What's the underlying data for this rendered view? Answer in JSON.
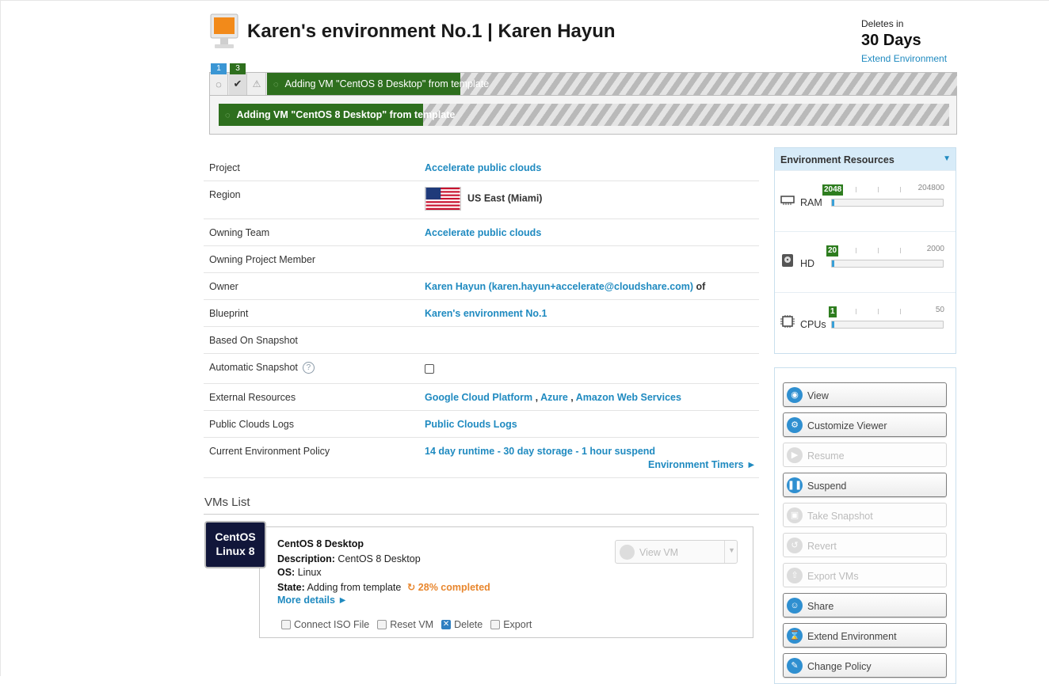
{
  "header": {
    "title": "Karen's environment No.1 | Karen Hayun",
    "deletes_label": "Deletes in",
    "deletes_value": "30 Days",
    "extend_link": "Extend Environment"
  },
  "taskbar": {
    "running_count": "1",
    "done_count": "3",
    "task_text": "Adding VM \"CentOS 8 Desktop\" from template",
    "progress_percent": 28
  },
  "details": {
    "project_label": "Project",
    "project_value": "Accelerate public clouds",
    "region_label": "Region",
    "region_value": "US East (Miami)",
    "owning_team_label": "Owning Team",
    "owning_team_value": "Accelerate public clouds",
    "owning_member_label": "Owning Project Member",
    "owner_label": "Owner",
    "owner_value": "Karen Hayun (karen.hayun+accelerate@cloudshare.com)",
    "owner_suffix": "of",
    "blueprint_label": "Blueprint",
    "blueprint_value": "Karen's environment No.1",
    "snapshot_label": "Based On Snapshot",
    "auto_snapshot_label": "Automatic Snapshot",
    "auto_snapshot_checked": false,
    "external_label": "External Resources",
    "external_values": [
      "Google Cloud Platform",
      "Azure",
      "Amazon Web Services"
    ],
    "logs_label": "Public Clouds Logs",
    "logs_value": "Public Clouds Logs",
    "policy_label": "Current Environment Policy",
    "policy_value": "14 day runtime - 30 day storage - 1 hour suspend",
    "timers_link": "Environment Timers ►"
  },
  "vms": {
    "title": "VMs List",
    "logo_line1": "CentOS",
    "logo_line2": "Linux 8",
    "name": "CentOS 8 Desktop",
    "description_label": "Description:",
    "description_value": "CentOS 8 Desktop",
    "os_label": "OS:",
    "os_value": "Linux",
    "state_label": "State:",
    "state_value": "Adding from template",
    "state_percent": "28% completed",
    "more_details": "More details ►",
    "view_vm": "View VM",
    "actions": [
      "Connect ISO File",
      "Reset VM",
      "Delete",
      "Export"
    ]
  },
  "resources": {
    "title": "Environment Resources",
    "ram": {
      "label": "RAM",
      "value": "2048",
      "max": "204800",
      "fraction": 0.01
    },
    "hd": {
      "label": "HD",
      "value": "20",
      "max": "2000",
      "fraction": 0.01
    },
    "cpus": {
      "label": "CPUs",
      "value": "1",
      "max": "50",
      "fraction": 0.02
    }
  },
  "actions": [
    {
      "label": "View",
      "enabled": true,
      "icon": "eye-icon"
    },
    {
      "label": "Customize Viewer",
      "enabled": true,
      "icon": "gear-icon"
    },
    {
      "label": "Resume",
      "enabled": false,
      "icon": "play-icon"
    },
    {
      "label": "Suspend",
      "enabled": true,
      "icon": "pause-icon"
    },
    {
      "label": "Take Snapshot",
      "enabled": false,
      "icon": "camera-icon"
    },
    {
      "label": "Revert",
      "enabled": false,
      "icon": "revert-icon"
    },
    {
      "label": "Export VMs",
      "enabled": false,
      "icon": "export-icon"
    },
    {
      "label": "Share",
      "enabled": true,
      "icon": "share-icon"
    },
    {
      "label": "Extend Environment",
      "enabled": true,
      "icon": "hourglass-icon"
    },
    {
      "label": "Change Policy",
      "enabled": true,
      "icon": "policy-icon"
    }
  ],
  "colors": {
    "link": "#1f8ac0",
    "progress": "#2e6f1e",
    "accent_orange": "#e8862d",
    "panel_header": "#d7ebf8"
  }
}
